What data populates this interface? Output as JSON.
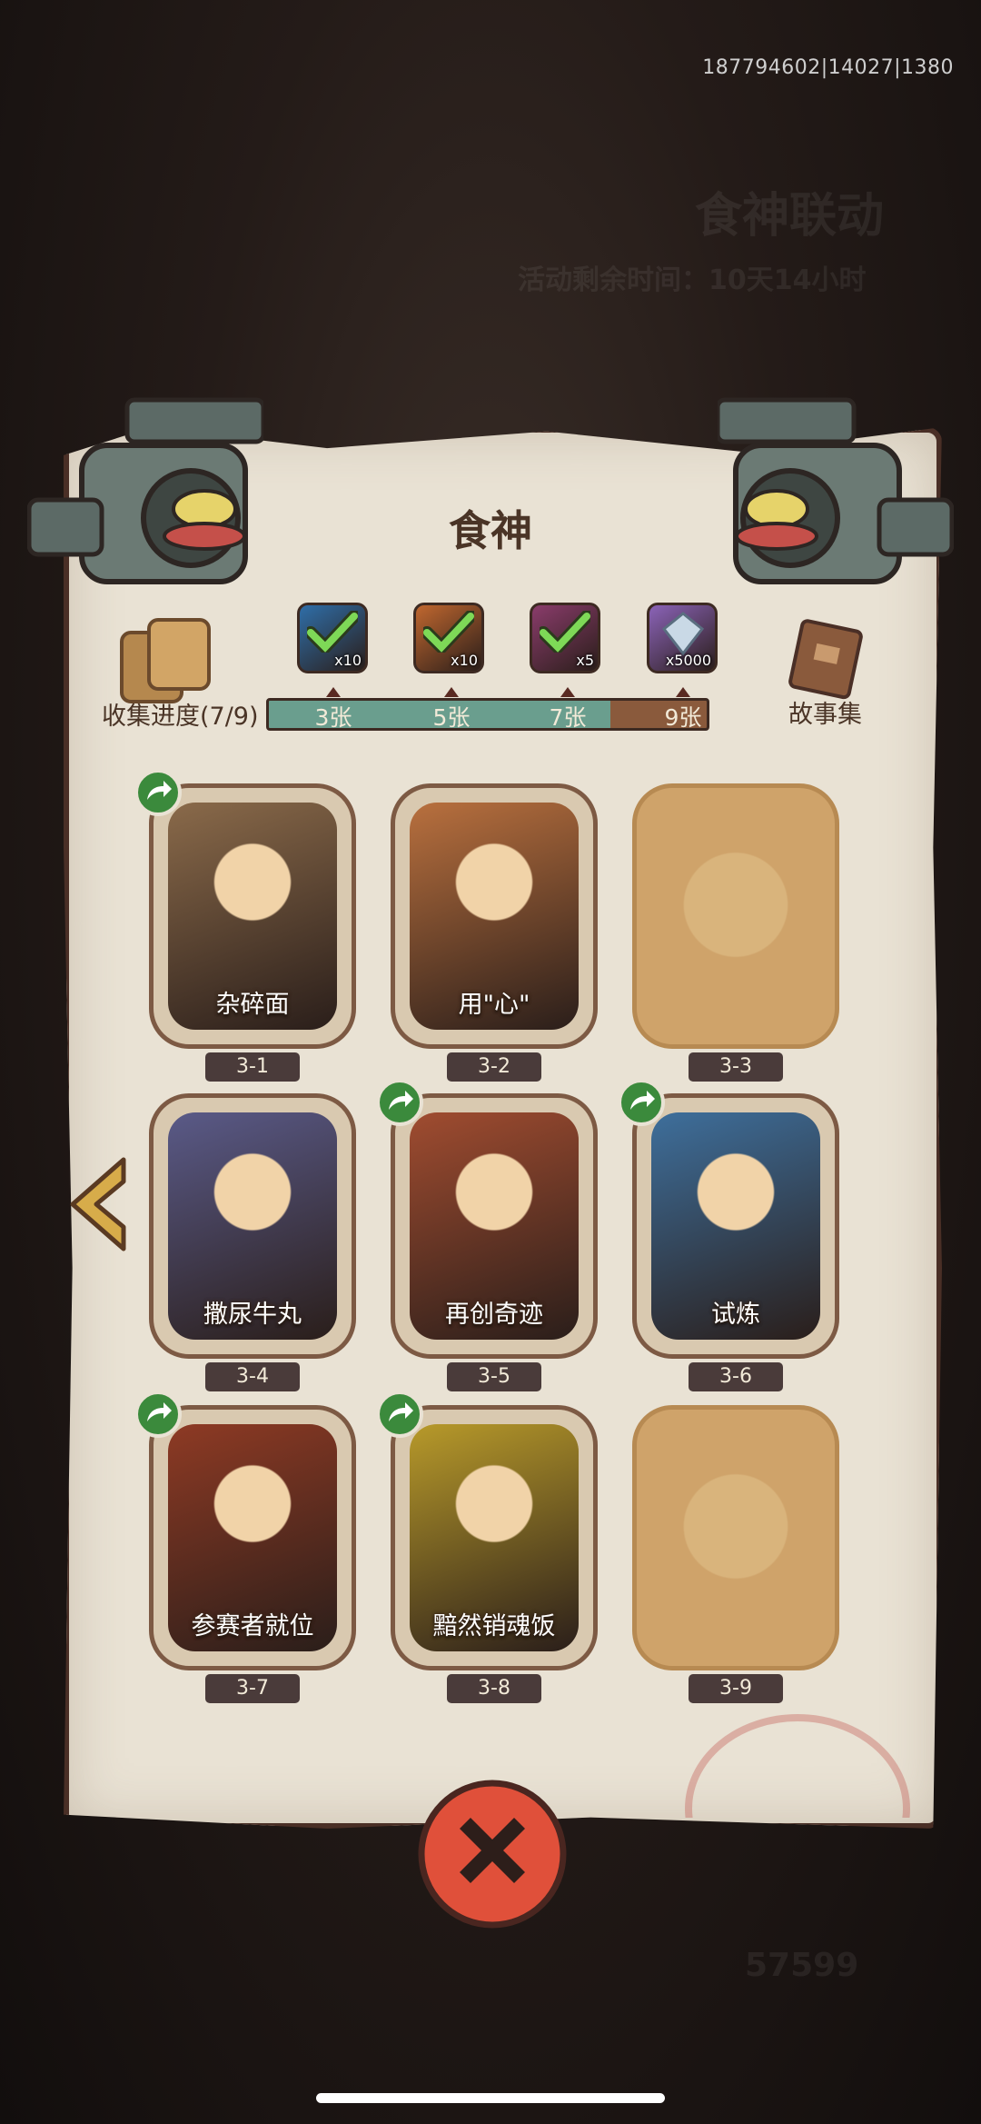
{
  "status_id": "187794602|14027|1380",
  "background": {
    "event_title": "食神联动",
    "timer_text": "活动剩余时间：10天14小时",
    "currency_value": "57599"
  },
  "panel": {
    "title": "食神",
    "collect_label": "收集进度(7/9)",
    "collect_progress": 0.78,
    "stories_label": "故事集"
  },
  "milestones": [
    {
      "label": "3张",
      "reward_qty": "x10",
      "color": "#2f6ea8",
      "claimed": true
    },
    {
      "label": "5张",
      "reward_qty": "x10",
      "color": "#c0672f",
      "claimed": true
    },
    {
      "label": "7张",
      "reward_qty": "x5",
      "color": "#8a3c6b",
      "claimed": true
    },
    {
      "label": "9张",
      "reward_qty": "x5000",
      "color": "#8b63b8",
      "claimed": false
    }
  ],
  "cards": [
    {
      "title": "杂碎面",
      "number": "3-1",
      "unlocked": true,
      "shared": true,
      "art": "#8a6a4a"
    },
    {
      "title": "用\"心\"",
      "number": "3-2",
      "unlocked": true,
      "shared": false,
      "art": "#b9703e"
    },
    {
      "title": "",
      "number": "3-3",
      "unlocked": false,
      "shared": false,
      "art": "#cfa36a"
    },
    {
      "title": "撒尿牛丸",
      "number": "3-4",
      "unlocked": true,
      "shared": false,
      "art": "#5a5a88"
    },
    {
      "title": "再创奇迹",
      "number": "3-5",
      "unlocked": true,
      "shared": true,
      "art": "#a04c30"
    },
    {
      "title": "试炼",
      "number": "3-6",
      "unlocked": true,
      "shared": true,
      "art": "#3e6f9c"
    },
    {
      "title": "参赛者就位",
      "number": "3-7",
      "unlocked": true,
      "shared": true,
      "art": "#8e3a24"
    },
    {
      "title": "黯然销魂饭",
      "number": "3-8",
      "unlocked": true,
      "shared": true,
      "art": "#b89a2a"
    },
    {
      "title": "",
      "number": "3-9",
      "unlocked": false,
      "shared": false,
      "art": "#cfa36a"
    }
  ],
  "colors": {
    "accent": "#e0503a",
    "bar_fill": "#6a9e8e",
    "share": "#3b8a3c"
  }
}
